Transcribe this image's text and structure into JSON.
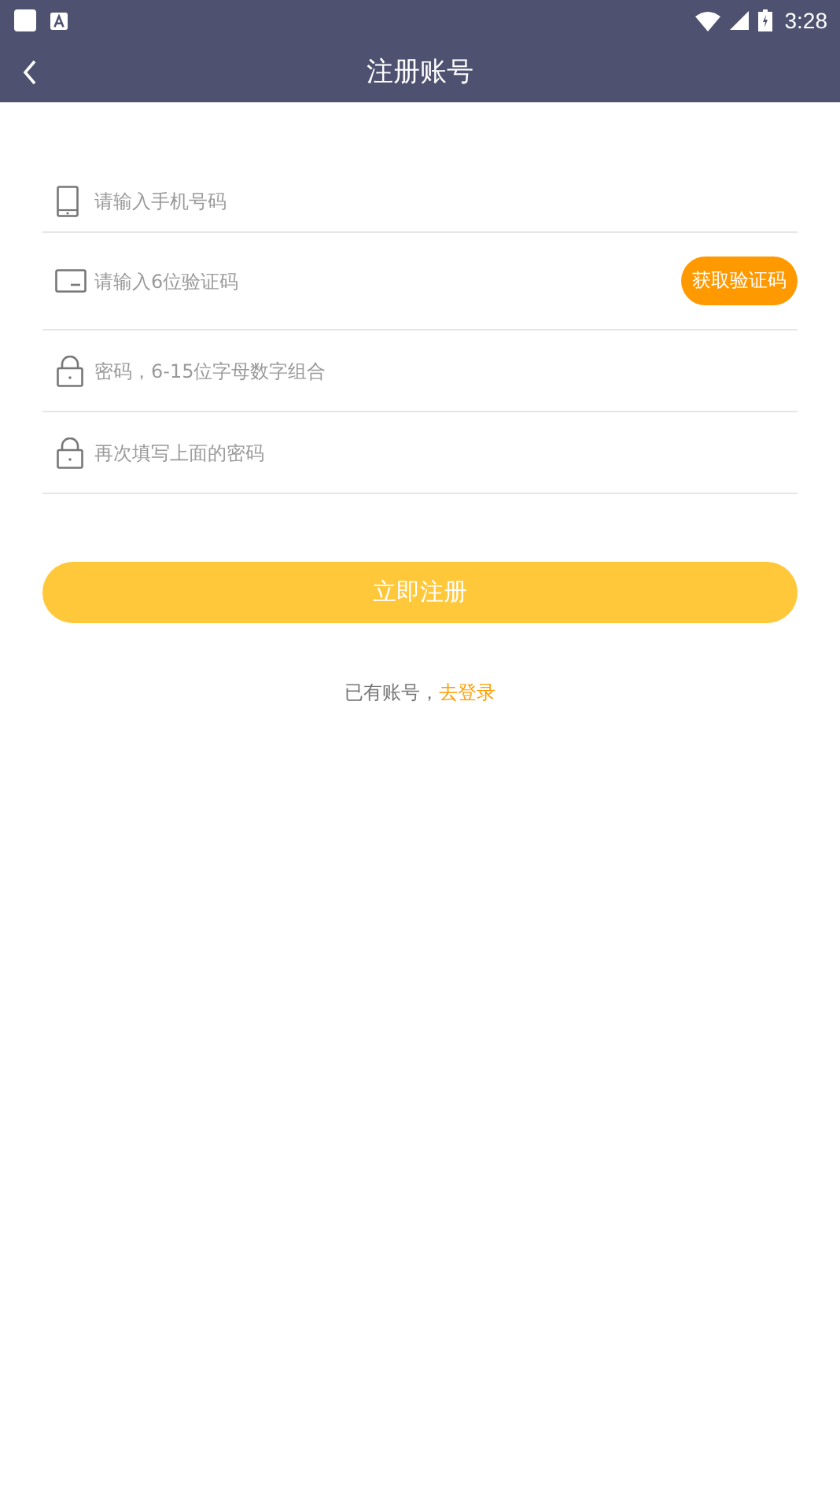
{
  "status_bar": {
    "time": "3:28"
  },
  "toolbar": {
    "title": "注册账号"
  },
  "fields": [
    {
      "kind": "phone",
      "placeholder": "请输入手机号码"
    },
    {
      "kind": "code",
      "placeholder": "请输入6位验证码",
      "action": "获取验证码"
    },
    {
      "kind": "lock",
      "placeholder": "密码，6-15位字母数字组合"
    },
    {
      "kind": "lock",
      "placeholder": "再次填写上面的密码"
    }
  ],
  "submit": "立即注册",
  "footer": {
    "text": "已有账号，",
    "link": "去登录"
  }
}
